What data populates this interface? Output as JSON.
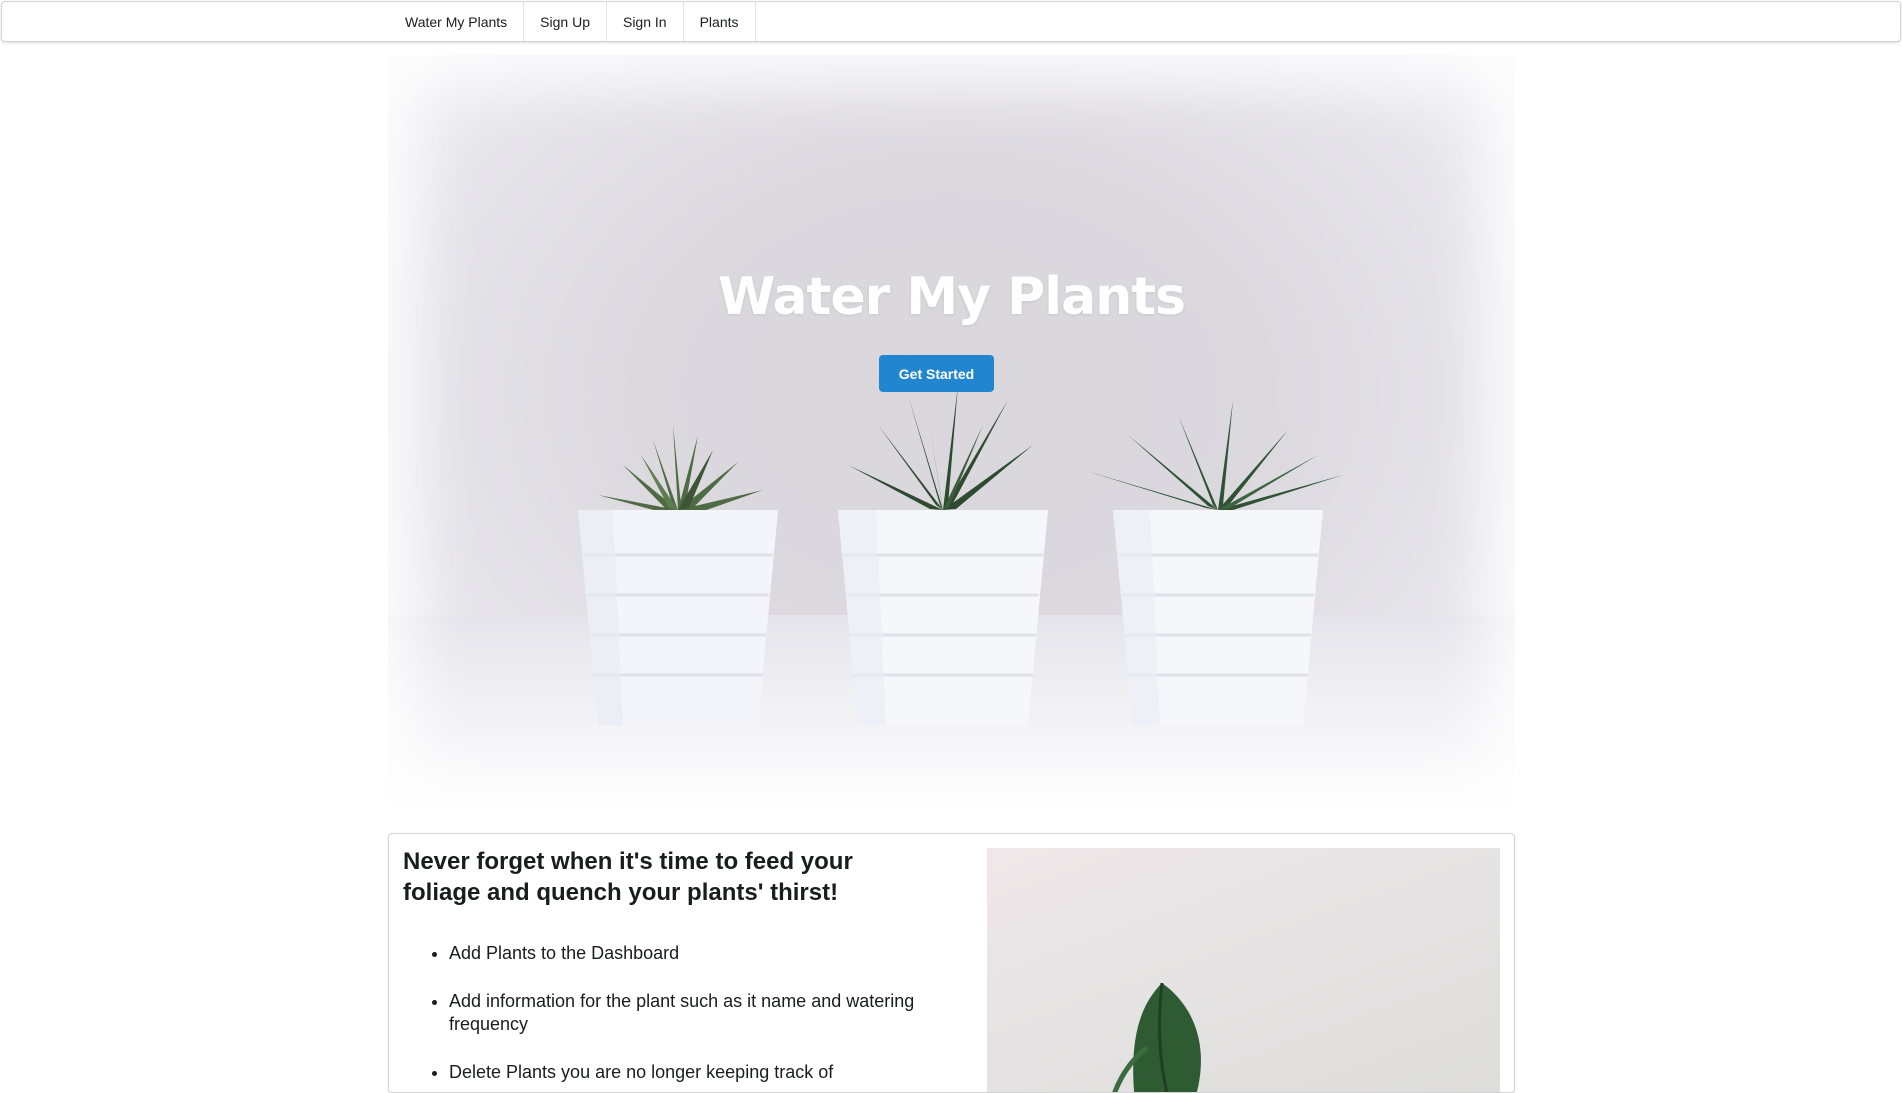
{
  "nav": {
    "items": [
      {
        "label": "Water My Plants"
      },
      {
        "label": "Sign Up"
      },
      {
        "label": "Sign In"
      },
      {
        "label": "Plants"
      }
    ]
  },
  "hero": {
    "title": "Water My Plants",
    "cta_label": "Get Started",
    "cta_color": "#2185d0"
  },
  "features": {
    "heading": "Never forget when it's time to feed your foliage and quench your plants' thirst!",
    "items": [
      "Add Plants to the Dashboard",
      "Add information for the plant such as it name and watering frequency",
      "Delete Plants you are no longer keeping track of"
    ]
  }
}
